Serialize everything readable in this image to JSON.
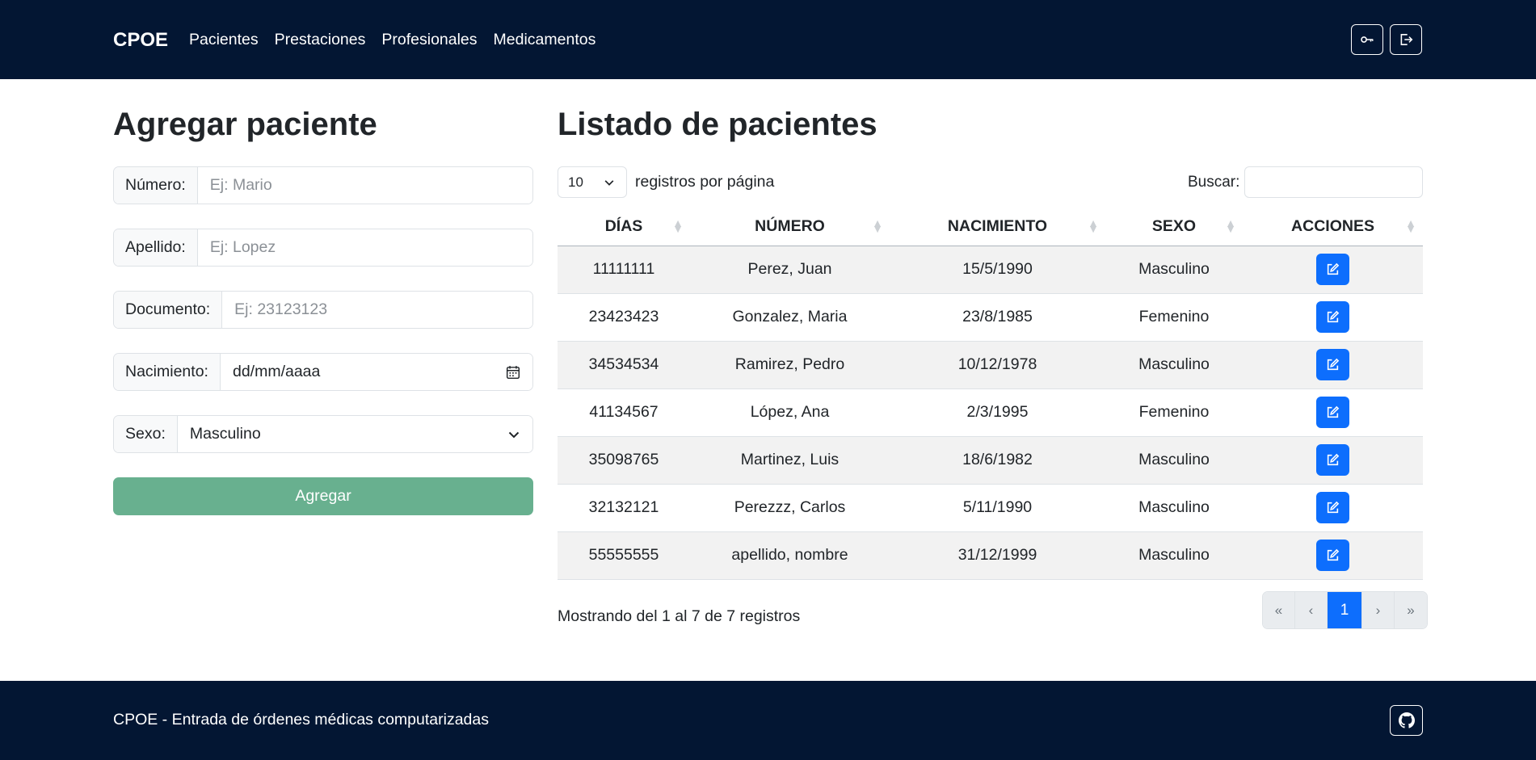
{
  "navbar": {
    "brand": "CPOE",
    "links": [
      "Pacientes",
      "Prestaciones",
      "Profesionales",
      "Medicamentos"
    ],
    "icons": [
      "key-icon",
      "logout-icon"
    ]
  },
  "form": {
    "title": "Agregar paciente",
    "numero": {
      "label": "Número:",
      "placeholder": "Ej: Mario"
    },
    "apellido": {
      "label": "Apellido:",
      "placeholder": "Ej: Lopez"
    },
    "documento": {
      "label": "Documento:",
      "placeholder": "Ej: 23123123"
    },
    "nacimiento": {
      "label": "Nacimiento:",
      "value": "dd/mm/aaaa"
    },
    "sexo": {
      "label": "Sexo:",
      "value": "Masculino"
    },
    "submit": "Agregar",
    "submit_color": "#68b08f"
  },
  "list": {
    "title": "Listado de pacientes",
    "page_length": "10",
    "page_length_label": "registros por página",
    "search_label": "Buscar:",
    "search_value": "",
    "headers": [
      "DÍAS",
      "NÚMERO",
      "NACIMIENTO",
      "SEXO",
      "ACCIONES"
    ],
    "rows": [
      {
        "dias": "11111111",
        "numero": "Perez, Juan",
        "nacimiento": "15/5/1990",
        "sexo": "Masculino"
      },
      {
        "dias": "23423423",
        "numero": "Gonzalez, Maria",
        "nacimiento": "23/8/1985",
        "sexo": "Femenino"
      },
      {
        "dias": "34534534",
        "numero": "Ramirez, Pedro",
        "nacimiento": "10/12/1978",
        "sexo": "Masculino"
      },
      {
        "dias": "41134567",
        "numero": "López, Ana",
        "nacimiento": "2/3/1995",
        "sexo": "Femenino"
      },
      {
        "dias": "35098765",
        "numero": "Martinez, Luis",
        "nacimiento": "18/6/1982",
        "sexo": "Masculino"
      },
      {
        "dias": "32132121",
        "numero": "Perezzz, Carlos",
        "nacimiento": "5/11/1990",
        "sexo": "Masculino"
      },
      {
        "dias": "55555555",
        "numero": "apellido, nombre",
        "nacimiento": "31/12/1999",
        "sexo": "Masculino"
      }
    ],
    "info": "Mostrando del 1 al 7 de 7 registros",
    "pagination": {
      "first": "«",
      "prev": "‹",
      "current": "1",
      "next": "›",
      "last": "»"
    },
    "accent_color": "#0d6efd"
  },
  "footer": {
    "text": "CPOE - Entrada de órdenes médicas computarizadas",
    "icon": "github-icon"
  }
}
